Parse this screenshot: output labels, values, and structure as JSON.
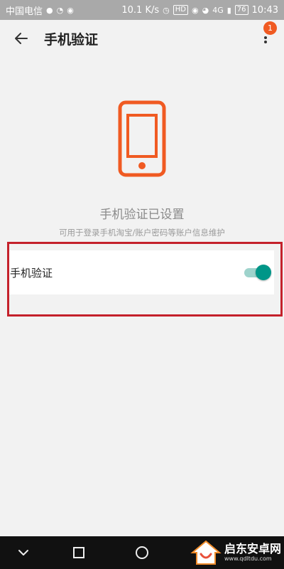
{
  "status_bar": {
    "carrier": "中国电信",
    "speed": "10.1 K/s",
    "hd": "HD",
    "network": "4G",
    "battery": "76",
    "time": "10:43"
  },
  "header": {
    "title": "手机验证",
    "badge_count": "1"
  },
  "main": {
    "headline": "手机验证已设置",
    "subtext": "可用于登录手机淘宝/账户密码等账户信息维护",
    "verify_row": {
      "label": "手机验证",
      "toggle_on": true
    }
  },
  "watermark": {
    "title": "启东安卓网",
    "url": "www.qdltdu.com"
  },
  "colors": {
    "accent_orange": "#f05a22",
    "toggle_teal": "#009688",
    "highlight_red": "#c4212b"
  },
  "icons": {
    "back": "arrow-left-icon",
    "more": "more-vertical-icon",
    "hero": "phone-icon",
    "nav_back": "chevron-down-icon",
    "nav_recents": "square-icon",
    "nav_home": "circle-icon"
  }
}
